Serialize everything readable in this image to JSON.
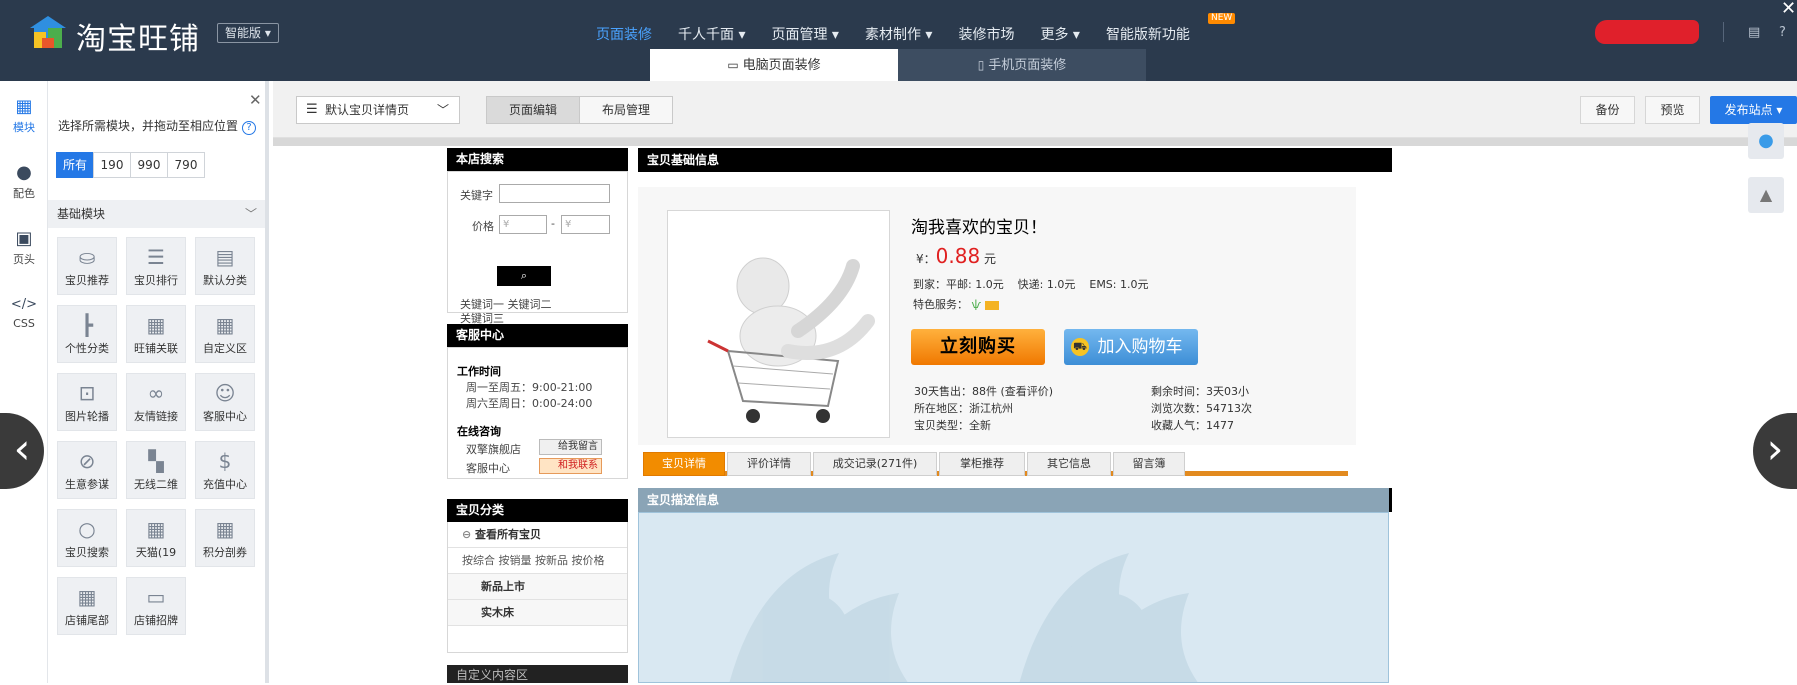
{
  "app": {
    "logo_text": "淘宝旺铺",
    "edition": "智能版 ▾",
    "new_badge": "NEW"
  },
  "nav": {
    "items": [
      "页面装修",
      "千人千面 ▾",
      "页面管理 ▾",
      "素材制作 ▾",
      "装修市场",
      "更多 ▾",
      "智能版新功能"
    ],
    "active_index": 0,
    "subtabs": [
      "电脑页面装修",
      "手机页面装修"
    ]
  },
  "rail": {
    "items": [
      "模块",
      "配色",
      "页头",
      "CSS"
    ]
  },
  "panel": {
    "hint": "选择所需模块，并拖动至相应位置",
    "size_tabs": [
      "所有",
      "190",
      "990",
      "790"
    ],
    "group": "基础模块",
    "modules": [
      "宝贝推荐",
      "宝贝排行",
      "默认分类",
      "个性分类",
      "旺铺关联",
      "自定义区",
      "图片轮播",
      "友情链接",
      "客服中心",
      "生意参谋",
      "无线二维",
      "充值中心",
      "宝贝搜索",
      "天猫(19",
      "积分剖券",
      "店铺尾部",
      "店铺招牌"
    ]
  },
  "toolbar": {
    "page_select": "默认宝贝详情页",
    "edit_mode": "页面编辑",
    "layout_mode": "布局管理",
    "backup": "备份",
    "preview": "预览",
    "publish": "发布站点 ▾"
  },
  "store_search": {
    "title": "本店搜索",
    "keyword_label": "关键字",
    "price_label": "价格",
    "price_min": "¥",
    "price_max": "¥",
    "dash": "-",
    "search_icon": "search-icon",
    "keywords_line1": "关键词一  关键词二",
    "keywords_line2": "关键词三"
  },
  "service": {
    "title": "客服中心",
    "hours_title": "工作时间",
    "weekday": "周一至周五：9:00-21:00",
    "weekend": "周六至周日：0:00-24:00",
    "consult_title": "在线咨询",
    "shop_name": "双擎旗舰店",
    "leave_msg": "给我留言",
    "service_label": "客服中心",
    "contact": "和我联系"
  },
  "category": {
    "title": "宝贝分类",
    "all": "查看所有宝贝",
    "sort_line": "按综合 按销量 按新品 按价格",
    "items": [
      "新品上市",
      "实木床"
    ],
    "custom": "自定义内容区"
  },
  "product": {
    "block_title": "宝贝基础信息",
    "name": "淘我喜欢的宝贝！",
    "currency": "¥：",
    "price": "0.88",
    "unit": "元",
    "shipping": "到家：平邮: 1.0元    快递: 1.0元    EMS: 1.0元",
    "service_label": "特色服务：",
    "buy": "立刻购买",
    "cart": "加入购物车",
    "stats_left": [
      "30天售出：88件 (查看评价)",
      "所在地区：浙江杭州",
      "宝贝类型：全新"
    ],
    "stats_right": [
      "剩余时间：3天03小",
      "浏览次数：54713次",
      "收藏人气：1477"
    ],
    "tabs": [
      "宝贝详情",
      "评价详情",
      "成交记录(271件)",
      "掌柜推荐",
      "其它信息",
      "留言簿"
    ],
    "active_tab": 0
  },
  "description": {
    "title": "宝贝描述信息"
  },
  "colors": {
    "topbar": "#2b3a4d",
    "accent": "#2478e6",
    "price": "#e02020",
    "orange": "#f28c00"
  }
}
